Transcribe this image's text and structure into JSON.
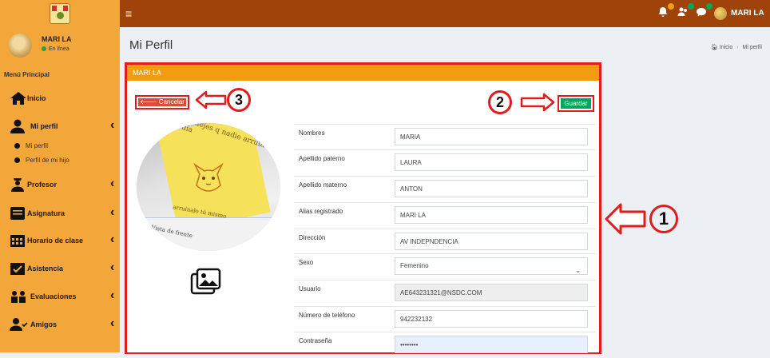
{
  "topbar": {
    "user_name": "MARI LA",
    "notifications": [
      {
        "icon": "bell-icon",
        "badge_color": "#f39c12"
      },
      {
        "icon": "users-icon",
        "badge_color": "#00a65a"
      },
      {
        "icon": "chat-icon",
        "badge_color": "#00a65a"
      }
    ],
    "colors": {
      "bar": "#a0430a",
      "logo_bg": "#f3a73a"
    }
  },
  "sidebar": {
    "user_name": "MARI LA",
    "status": "En línea",
    "menu_header": "Menú Principal",
    "items": [
      {
        "label": "Inicio",
        "icon": "home-icon"
      },
      {
        "label": "Mi perfil",
        "icon": "user-icon"
      },
      {
        "label": "Profesor",
        "icon": "teacher-icon"
      },
      {
        "label": "Asignatura",
        "icon": "book-icon"
      },
      {
        "label": "Horario de clase",
        "icon": "calendar-icon"
      },
      {
        "label": "Asistencia",
        "icon": "calendar-check-icon"
      },
      {
        "label": "Evaluaciones",
        "icon": "group-icon"
      },
      {
        "label": "Amigos",
        "icon": "user-check-icon"
      }
    ],
    "subitems": [
      {
        "label": "Mi perfil"
      },
      {
        "label": "Perfil de mi hijo"
      }
    ]
  },
  "page": {
    "title": "Mi Perfil",
    "breadcrumb": [
      "Inicio",
      "Mi perfil"
    ]
  },
  "panel": {
    "title": "MARI LA",
    "cancel_label": "Cancelar",
    "save_label": "Guardar",
    "photo_texts": [
      "no dejes q nadie arruine tu día",
      "arruínalo tú mismo",
      "Vista de frente"
    ],
    "fields": [
      {
        "label": "Nombres",
        "value": "MARIA"
      },
      {
        "label": "Apellido paterno",
        "value": "LAURA"
      },
      {
        "label": "Apellido materno",
        "value": "ANTON"
      },
      {
        "label": "Alias registrado",
        "value": "MARI LA"
      },
      {
        "label": "Dirección",
        "value": "AV INDEPNDENCIA"
      },
      {
        "label": "Sexo",
        "value": "Femenino"
      },
      {
        "label": "Usuario",
        "value": "AE643231321@NSDC.COM"
      },
      {
        "label": "Número de teléfono",
        "value": "942232132"
      },
      {
        "label": "Contraseña",
        "value": "••••••••"
      }
    ]
  },
  "annotations": [
    "1",
    "2",
    "3"
  ]
}
